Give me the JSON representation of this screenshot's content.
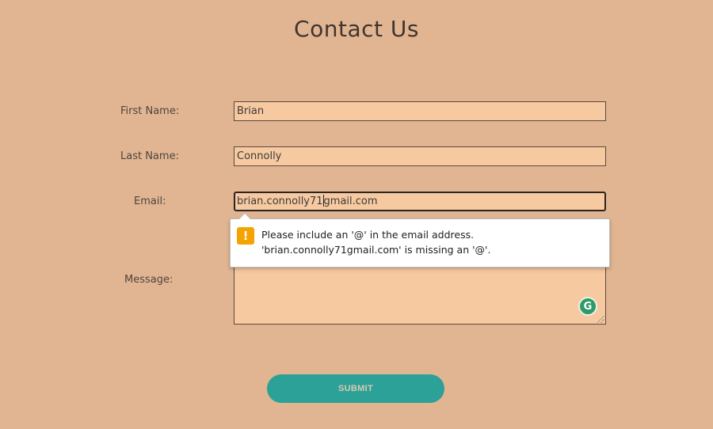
{
  "page": {
    "title": "Contact Us"
  },
  "form": {
    "first_name_label": "First Name:",
    "first_name_value": "Brian",
    "last_name_label": "Last Name:",
    "last_name_value": "Connolly",
    "email_label": "Email:",
    "email_value_before_caret": "brian.connolly71",
    "email_value_after_caret": "gmail.com",
    "message_label": "Message:",
    "message_value": "",
    "submit_label": "SUBMIT"
  },
  "validation_tooltip": {
    "icon": "warning-icon",
    "line1": "Please include an '@' in the email address.",
    "line2": "'brian.connolly71gmail.com' is missing an '@'."
  },
  "grammarly_badge": {
    "icon": "grammarly-icon",
    "glyph": "G"
  },
  "colors": {
    "background": "#e1b591",
    "field_background": "#f6c9a0",
    "submit_button": "#2ca197",
    "warning": "#f4a300",
    "grammarly": "#2f9a67"
  }
}
